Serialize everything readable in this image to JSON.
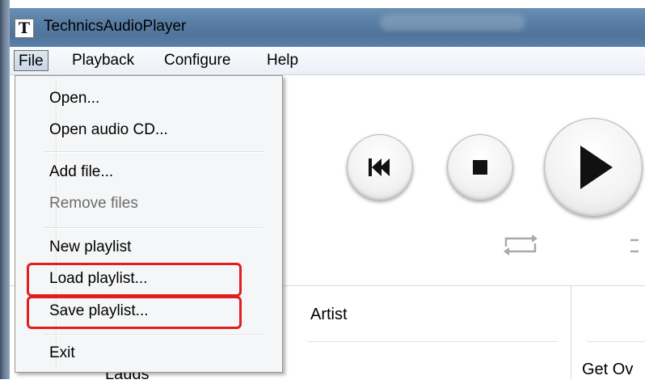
{
  "window": {
    "title": "TechnicsAudioPlayer",
    "app_icon_letter": "T"
  },
  "menubar": {
    "items": [
      {
        "label": "File",
        "active": true
      },
      {
        "label": "Playback"
      },
      {
        "label": "Configure"
      },
      {
        "label": "Help"
      }
    ]
  },
  "file_menu": {
    "items": [
      {
        "label": "Open...",
        "enabled": true
      },
      {
        "label": "Open audio CD...",
        "enabled": true
      },
      {
        "label": "Add file...",
        "enabled": true
      },
      {
        "label": "Remove files",
        "enabled": false
      },
      {
        "label": "New playlist",
        "enabled": true
      },
      {
        "label": "Load playlist...",
        "enabled": true,
        "highlighted": true
      },
      {
        "label": "Save playlist...",
        "enabled": true,
        "highlighted": true
      },
      {
        "label": "Exit",
        "enabled": true
      }
    ]
  },
  "controls": {
    "buttons": [
      "previous-icon",
      "stop-icon",
      "play-icon"
    ],
    "toggles": [
      "repeat-icon",
      "shuffle-icon"
    ]
  },
  "playlist": {
    "columns": {
      "artist": "Artist"
    },
    "partial_cells": {
      "left": "Lauds",
      "right": "Get Ov"
    }
  },
  "colors": {
    "highlight": "#e01e1e",
    "title_bar": "#5a7fa6",
    "menu_bg": "#f5f6f7"
  }
}
